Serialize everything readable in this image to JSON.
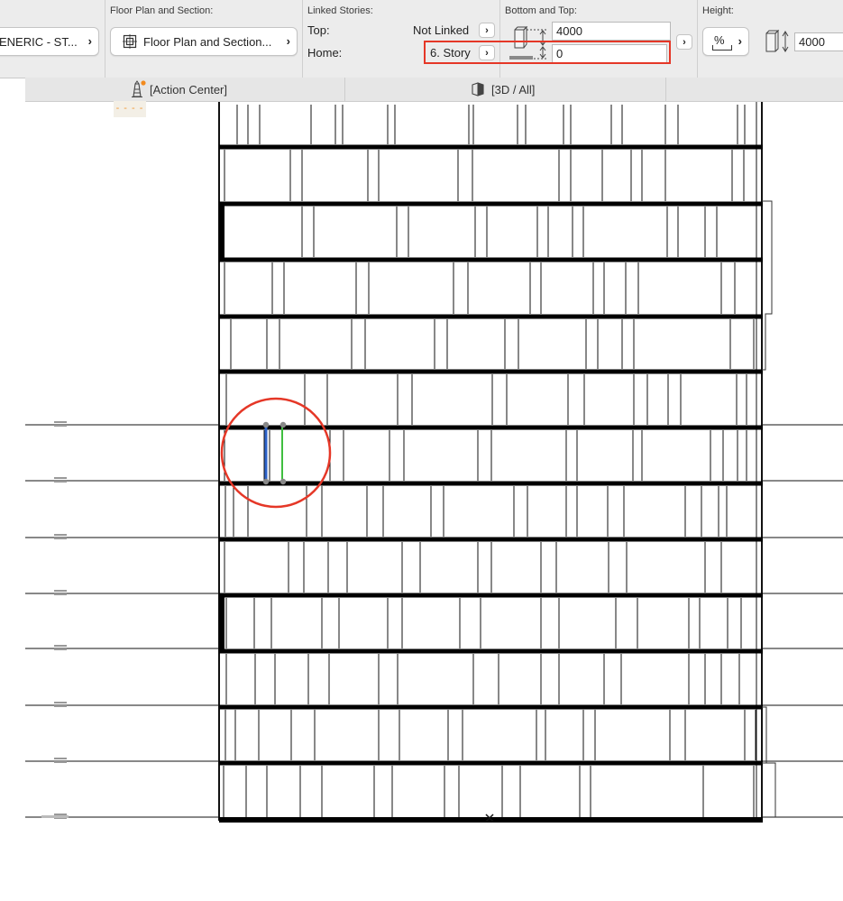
{
  "toolbar": {
    "structure_pill": "ENERIC - ST...",
    "floor_plan": {
      "label": "Floor Plan and Section:",
      "button": "Floor Plan and Section..."
    },
    "linked_stories": {
      "label": "Linked Stories:",
      "top_label": "Top:",
      "top_value": "Not Linked",
      "home_label": "Home:",
      "home_value": "6. Story"
    },
    "bottom_top": {
      "label": "Bottom and Top:",
      "top_value": "4000",
      "bottom_value": "0"
    },
    "height": {
      "label": "Height:",
      "percent_symbol": "%",
      "value": "4000"
    }
  },
  "tabs": [
    {
      "label": "[Action Center]",
      "icon": "lighthouse-icon"
    },
    {
      "label": "[3D / All]",
      "icon": "cube-3d-icon"
    }
  ],
  "colors": {
    "highlight_red": "#e53727",
    "selection_blue": "#2d63c9",
    "selection_green": "#3fbf3f",
    "notification_orange": "#f28a1e"
  }
}
